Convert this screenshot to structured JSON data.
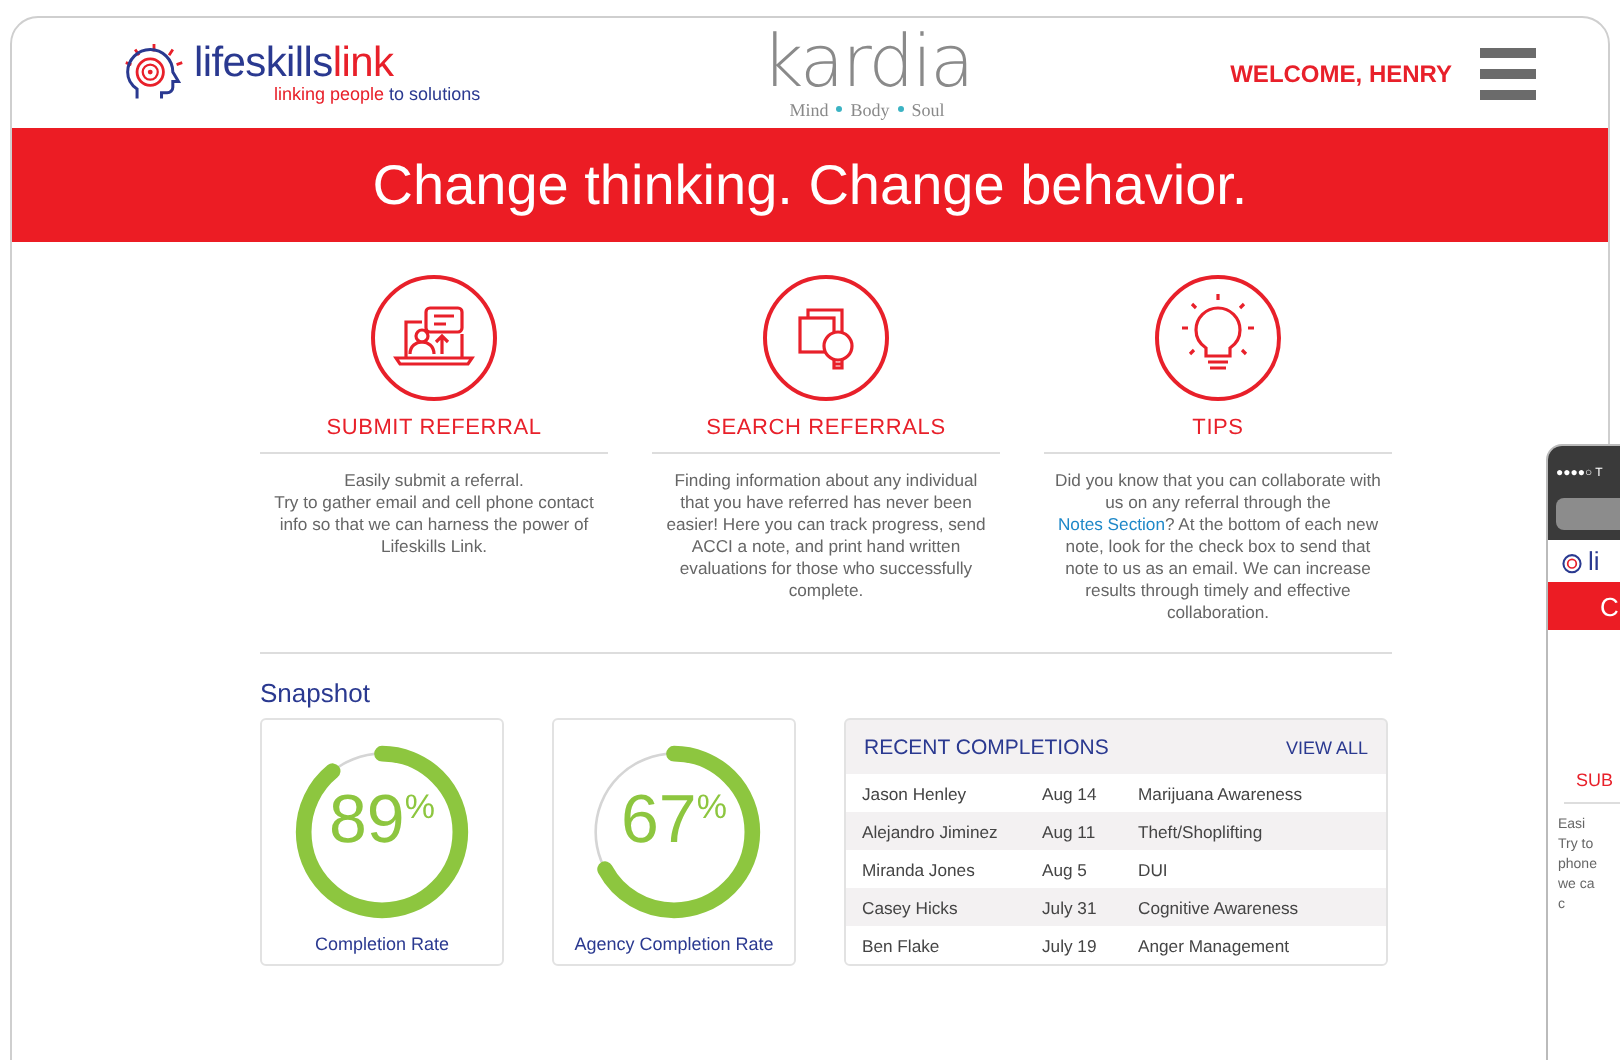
{
  "header": {
    "brand": {
      "name": "lifeskills",
      "accent": "link",
      "tagline_red": "linking people",
      "tagline_blue": "to solutions"
    },
    "partner": {
      "name": "kardia",
      "words": [
        "Mind",
        "Body",
        "Soul"
      ]
    },
    "welcome": "WELCOME, HENRY"
  },
  "banner": "Change thinking. Change behavior.",
  "features": [
    {
      "kind": "referral",
      "title": "SUBMIT REFERRAL",
      "text": "Easily submit a referral.\nTry to gather email and cell phone contact info so that we can harness the power of Lifeskills Link."
    },
    {
      "kind": "search",
      "title": "SEARCH REFERRALS",
      "text": "Finding information about any individual that you have referred has never been easier! Here you can track progress, send ACCI a note, and print hand written evaluations for those who successfully complete."
    },
    {
      "kind": "tips",
      "title": "TIPS",
      "text": "Did you know that you can collaborate with us on any referral through the ",
      "link": "Notes Section",
      "text_after": "? At the bottom of each new note, look for the check box to send that note to us as an email. We can increase results through timely and effective collaboration."
    }
  ],
  "snapshot": {
    "title": "Snapshot",
    "gauges": [
      {
        "value": "89",
        "unit": "%",
        "level": 0.89,
        "label": "Completion Rate"
      },
      {
        "value": "67",
        "unit": "%",
        "level": 0.67,
        "label": "Agency Completion Rate"
      }
    ],
    "recent": {
      "title": "RECENT COMPLETIONS",
      "action": "VIEW ALL",
      "rows": [
        {
          "name": "Jason Henley",
          "date": "Aug 14",
          "course": "Marijuana Awareness"
        },
        {
          "name": "Alejandro Jiminez",
          "date": "Aug 11",
          "course": "Theft/Shoplifting"
        },
        {
          "name": "Miranda Jones",
          "date": "Aug 5",
          "course": "DUI"
        },
        {
          "name": "Casey Hicks",
          "date": "July 31",
          "course": "Cognitive Awareness"
        },
        {
          "name": "Ben Flake",
          "date": "July 19",
          "course": "Anger Management"
        }
      ]
    }
  },
  "phone": {
    "status": "●●●●○ T",
    "brand": "li",
    "banner": "C",
    "title": "SUB",
    "lines": [
      "Easi",
      "Try to",
      "phone",
      "we ca",
      "c"
    ]
  }
}
